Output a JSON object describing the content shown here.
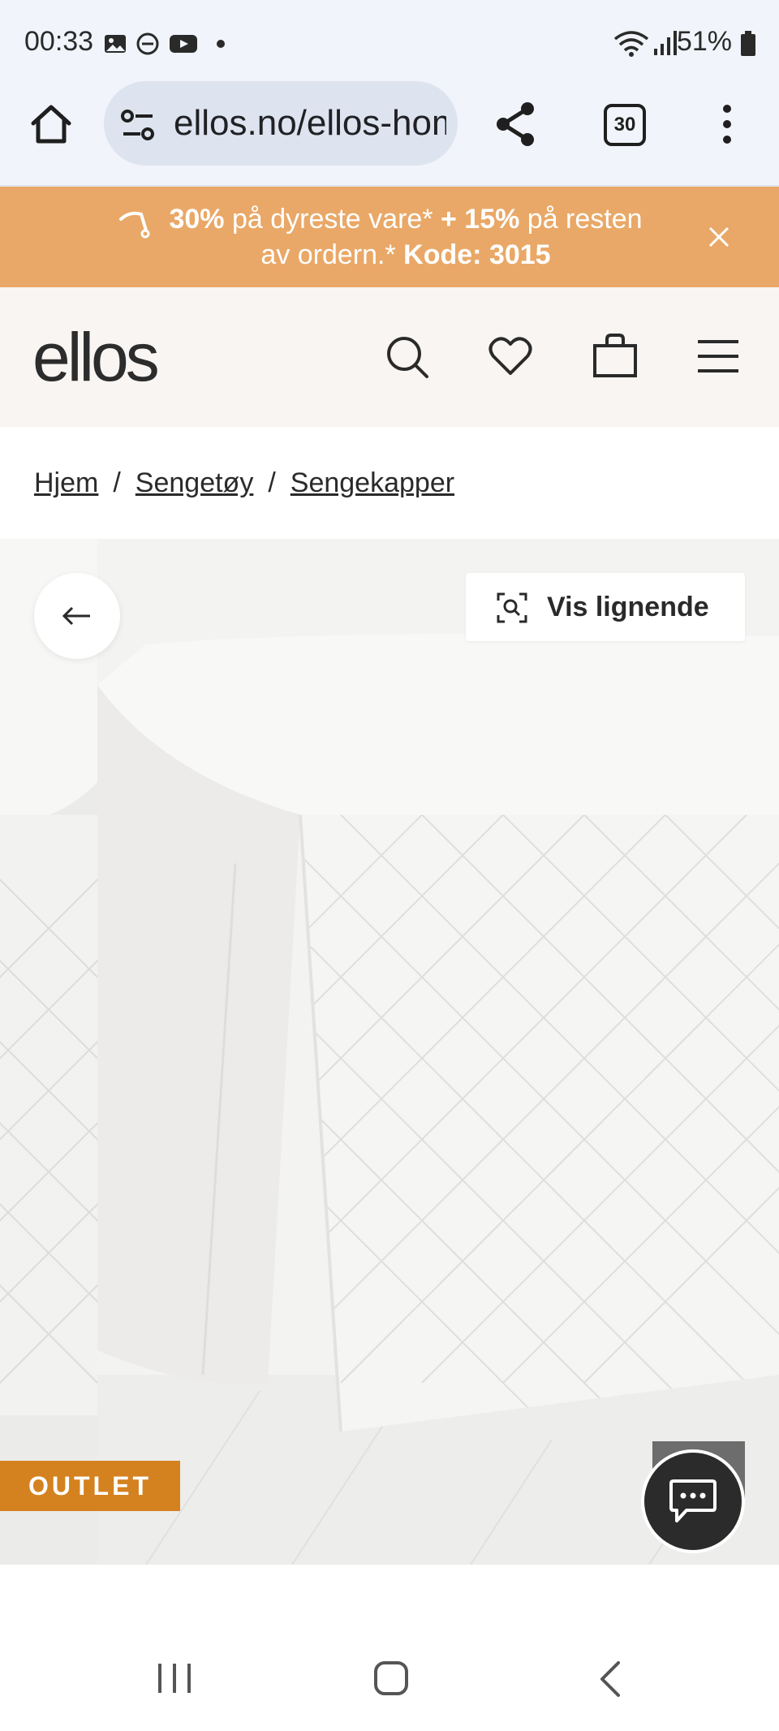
{
  "status_bar": {
    "time": "00:33",
    "battery": "51%",
    "icons": [
      "gallery-icon",
      "dnd-icon",
      "youtube-icon",
      "dot-icon",
      "wifi-icon",
      "signal-icon",
      "battery-icon"
    ]
  },
  "browser": {
    "url": "ellos.no/ellos-home",
    "tab_count": "30",
    "icons": [
      "home-icon",
      "site-settings-icon",
      "share-icon",
      "tabs-icon",
      "more-icon"
    ]
  },
  "promo": {
    "pct1": "30%",
    "text1": " på dyreste vare* ",
    "pct2": "+ 15%",
    "text2": " på resten",
    "text3": "av ordern.* ",
    "code": "Kode: 3015"
  },
  "header": {
    "logo": "ellos",
    "icons": [
      "search-icon",
      "heart-icon",
      "bag-icon",
      "menu-icon"
    ]
  },
  "breadcrumb": {
    "items": [
      "Hjem",
      "Sengetøy",
      "Sengekapper"
    ],
    "separator": "/"
  },
  "gallery": {
    "similar_label": "Vis lignende",
    "badge": "OUTLET"
  },
  "colors": {
    "promo_bg": "#e9a867",
    "badge_bg": "#d4821f",
    "header_bg": "#f8f5f2"
  }
}
